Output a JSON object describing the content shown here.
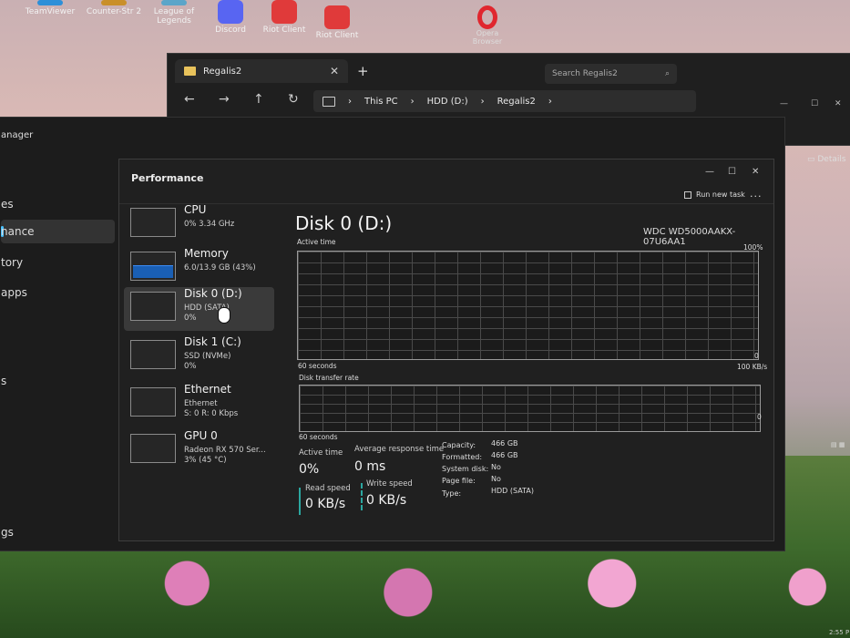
{
  "desktop": {
    "icons": [
      {
        "label": "TeamViewer",
        "color": "#2d8fd8"
      },
      {
        "label": "Counter-Str 2",
        "color": "#c98f2a"
      },
      {
        "label": "League of Legends",
        "color": "#5ba5c9"
      },
      {
        "label": "Discord",
        "color": "#5865f2"
      },
      {
        "label": "Riot Client",
        "color": "#e03a3a"
      },
      {
        "label": "Riot Client",
        "color": "#e03a3a"
      }
    ],
    "opera_label": "Opera Browser"
  },
  "explorer": {
    "tab_title": "Regalis2",
    "breadcrumb": [
      "This PC",
      "HDD (D:)",
      "Regalis2"
    ],
    "search_placeholder": "Search Regalis2",
    "details_label": "Details"
  },
  "task_manager_back": {
    "title": "anager",
    "sidebar": [
      "es",
      "nance",
      "tory",
      "apps",
      "s",
      "gs"
    ]
  },
  "performance": {
    "title": "Performance",
    "run_new_task": "Run new task",
    "devices": [
      {
        "name": "CPU",
        "line1": "0% 3.34 GHz",
        "line2": "",
        "selected": false,
        "graph_fill": 0
      },
      {
        "name": "Memory",
        "line1": "6.0/13.9 GB (43%)",
        "line2": "",
        "selected": false,
        "graph_fill": 0.43
      },
      {
        "name": "Disk 0 (D:)",
        "line1": "HDD (SATA)",
        "line2": "0%",
        "selected": true,
        "graph_fill": 0
      },
      {
        "name": "Disk 1 (C:)",
        "line1": "SSD (NVMe)",
        "line2": "0%",
        "selected": false,
        "graph_fill": 0
      },
      {
        "name": "Ethernet",
        "line1": "Ethernet",
        "line2": "S: 0 R: 0 Kbps",
        "selected": false,
        "graph_fill": 0
      },
      {
        "name": "GPU 0",
        "line1": "Radeon RX 570 Ser...",
        "line2": "3% (45 °C)",
        "selected": false,
        "graph_fill": 0
      }
    ],
    "detail": {
      "title": "Disk 0 (D:)",
      "model": "WDC WD5000AAKX-07U6AA1",
      "active_time_label": "Active time",
      "active_max": "100%",
      "active_min": "0",
      "time_span": "60 seconds",
      "transfer_label": "Disk transfer rate",
      "transfer_max": "100 KB/s",
      "transfer_min": "0",
      "stats": {
        "active_time_label": "Active time",
        "active_time_value": "0%",
        "avg_response_label": "Average response time",
        "avg_response_value": "0 ms",
        "read_label": "Read speed",
        "read_value": "0 KB/s",
        "write_label": "Write speed",
        "write_value": "0 KB/s"
      },
      "props": [
        {
          "k": "Capacity:",
          "v": "466 GB"
        },
        {
          "k": "Formatted:",
          "v": "466 GB"
        },
        {
          "k": "System disk:",
          "v": "No"
        },
        {
          "k": "Page file:",
          "v": "No"
        },
        {
          "k": "Type:",
          "v": "HDD (SATA)"
        }
      ]
    }
  },
  "taskbar": {
    "clock": "2:55 P"
  }
}
